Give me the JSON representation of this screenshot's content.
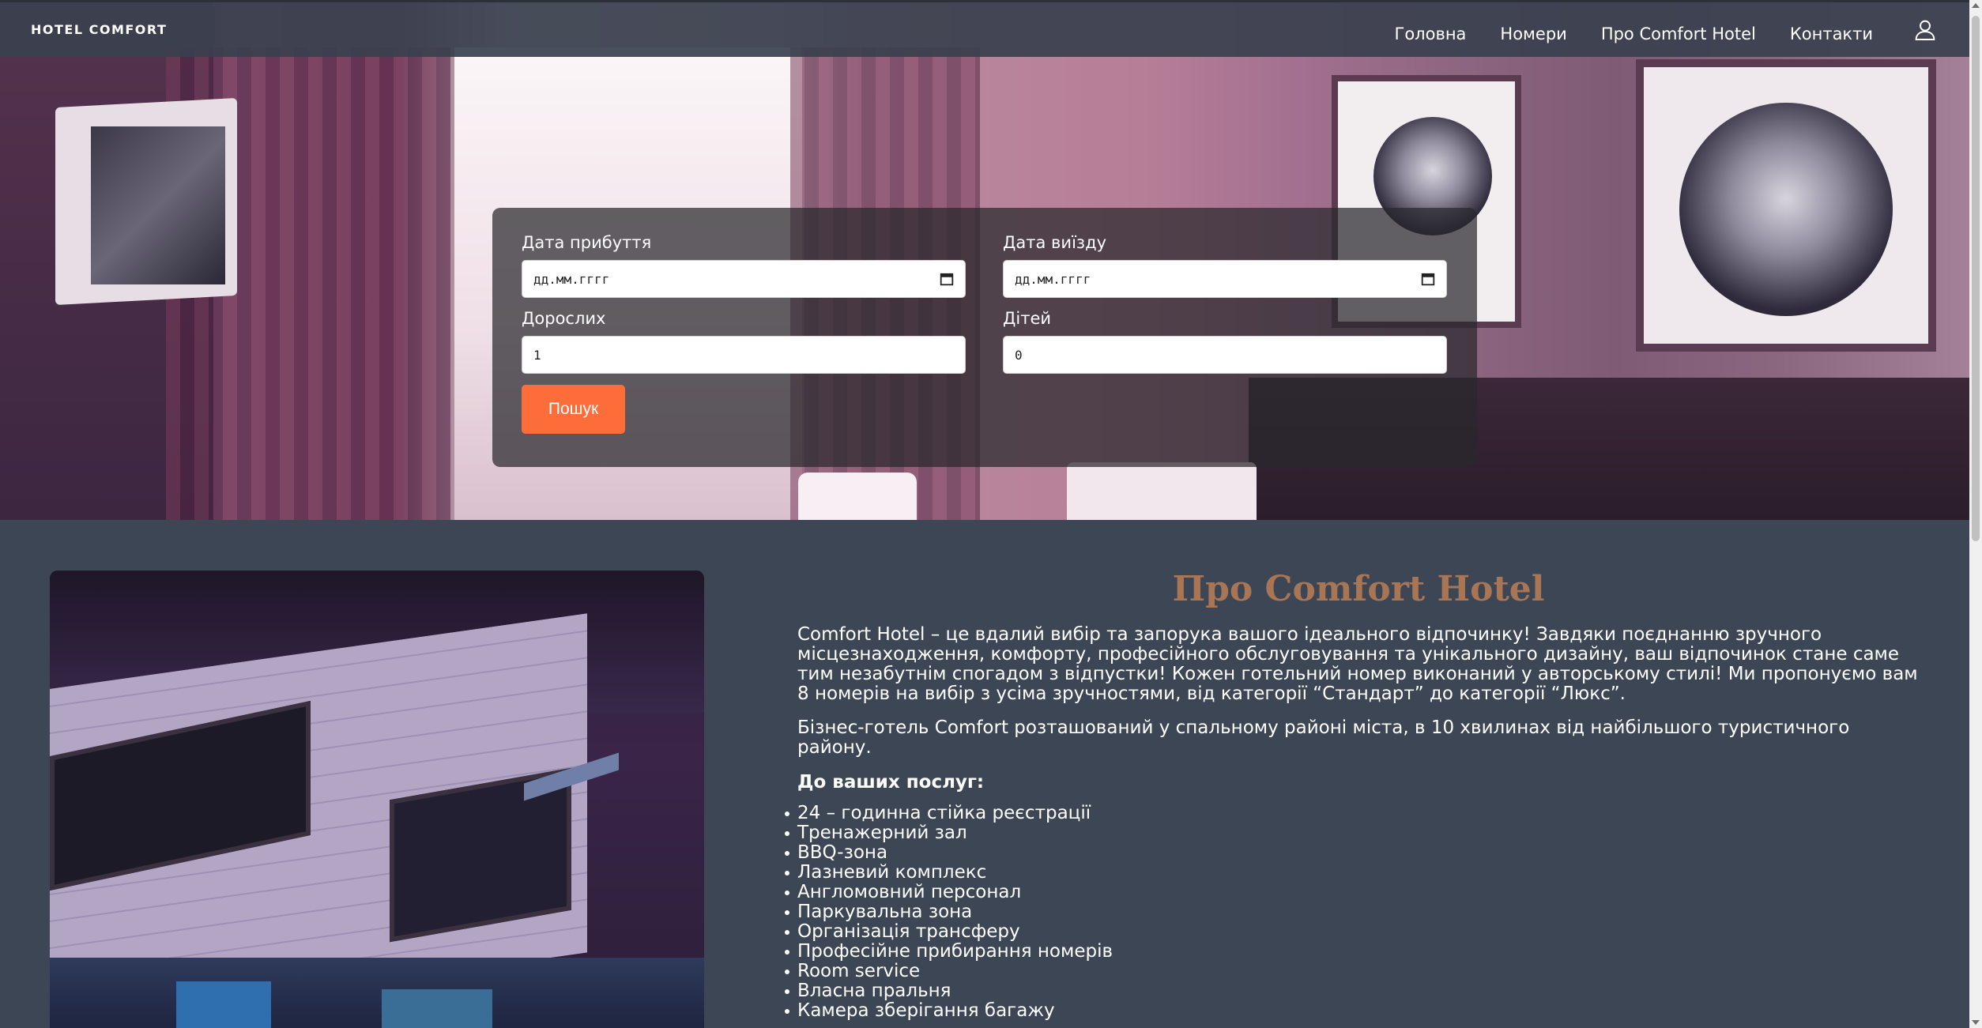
{
  "brand": "HOTEL COMFORT",
  "nav": {
    "items": [
      "Головна",
      "Номери",
      "Про Comfort Hotel",
      "Контакти"
    ]
  },
  "booking": {
    "arrival_label": "Дата прибуття",
    "arrival_value": "дд.мм.гггг",
    "departure_label": "Дата виїзду",
    "departure_value": "дд.мм.гггг",
    "adults_label": "Дорослих",
    "adults_value": "1",
    "children_label": "Дітей",
    "children_value": "0",
    "search_label": "Пошук"
  },
  "about": {
    "title": "Про Comfort Hotel",
    "p1": "Comfort Hotel – це вдалий вибір та запорука вашого ідеального відпочинку! Завдяки поєднанню зручного місцезнаходження, комфорту, професійного обслуговування та унікального дизайну, ваш відпочинок стане саме тим незабутнім спогадом з відпустки! Кожен готельний номер виконаний у авторському стилі! Ми пропонуємо вам 8 номерів на вибір з усіма зручностями, від категорії “Стандарт” до категорії “Люкс”.",
    "p2": "Бізнес-готель Comfort розташований у спальному районі міста, в 10 хвилинах від найбільшого туристичного району.",
    "services_title": "До ваших послуг:",
    "services": [
      "24 – годинна стійка реєстрації",
      "Тренажерний зал",
      "BBQ-зона",
      "Лазневий комплекс",
      "Англомовний персонал",
      "Паркувальна зона",
      "Організація трансферу",
      "Професійне прибирання номерів",
      "Room service",
      "Власна пральня",
      "Камера зберігання багажу"
    ]
  },
  "colors": {
    "accent": "#fd6d3a",
    "title": "#a87555",
    "background": "#3d4655"
  },
  "icons": {
    "user": "user-icon",
    "calendar": "calendar-icon"
  }
}
